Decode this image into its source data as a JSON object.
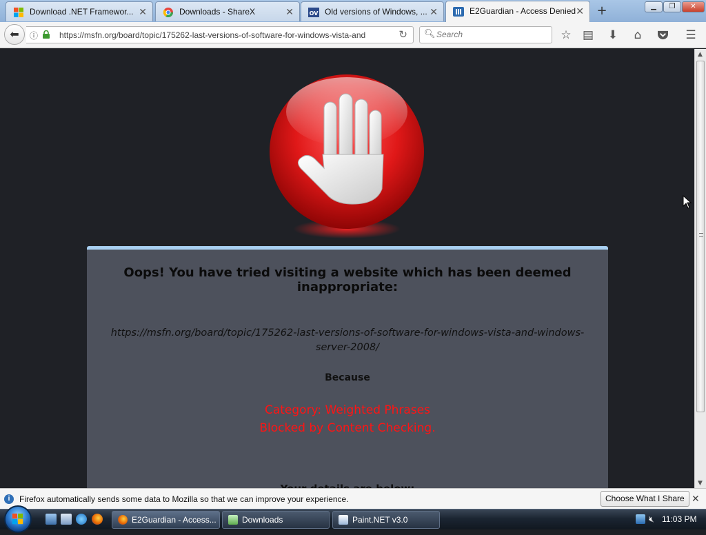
{
  "browser": {
    "tabs": [
      {
        "title": "Download .NET Framewor...",
        "favicon": "windows-logo-icon",
        "active": false
      },
      {
        "title": "Downloads - ShareX",
        "favicon": "chrome-like-icon",
        "active": false
      },
      {
        "title": "Old versions of Windows, ...",
        "favicon": "ov-logo-icon",
        "active": false
      },
      {
        "title": "E2Guardian - Access Denied",
        "favicon": "e2guardian-icon",
        "active": true
      }
    ],
    "new_tab_label": "+",
    "address": "https://msfn.org/board/topic/175262-last-versions-of-software-for-windows-vista-and",
    "search_placeholder": "Search"
  },
  "page": {
    "heading": "Oops! You have tried visiting a website which has been deemed inappropriate:",
    "blocked_url": "https://msfn.org/board/topic/175262-last-versions-of-software-for-windows-vista-and-windows-server-2008/",
    "because_label": "Because",
    "reason_category": "Category: Weighted Phrases",
    "reason_detail": "Blocked by Content Checking.",
    "details_label": "Your details are below:"
  },
  "notification": {
    "message": "Firefox automatically sends some data to Mozilla so that we can improve your experience.",
    "button_label": "Choose What I Share"
  },
  "taskbar": {
    "tasks": [
      {
        "label": "E2Guardian - Access...",
        "active": true
      },
      {
        "label": "Downloads",
        "active": false
      },
      {
        "label": "Paint.NET v3.0",
        "active": false
      }
    ],
    "clock": "11:03 PM"
  },
  "colors": {
    "page_background": "#1f2126",
    "panel_background": "#4d515c",
    "panel_top_border": "#a8d0f2",
    "reason_text": "#ff1414",
    "stop_sign_red": "#e01818"
  }
}
